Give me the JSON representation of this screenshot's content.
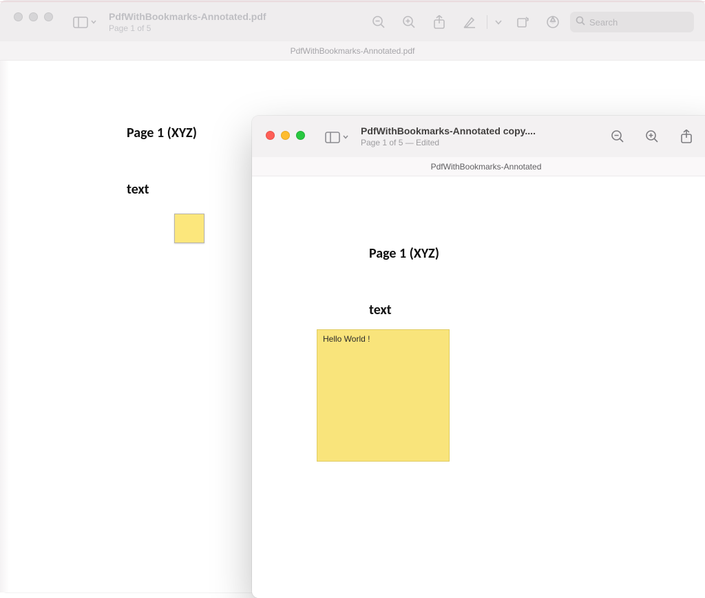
{
  "win1": {
    "filename": "PdfWithBookmarks-Annotated.pdf",
    "page_status": "Page 1 of 5",
    "tab_label": "PdfWithBookmarks-Annotated.pdf",
    "search_placeholder": "Search",
    "doc": {
      "heading": "Page 1 (XYZ)",
      "label": "text"
    }
  },
  "win2": {
    "filename": "PdfWithBookmarks-Annotated copy....",
    "page_status": "Page 1 of 5 — Edited",
    "tab_label": "PdfWithBookmarks-Annotated",
    "doc": {
      "heading": "Page 1 (XYZ)",
      "label": "text",
      "note_text": "Hello World !"
    }
  }
}
